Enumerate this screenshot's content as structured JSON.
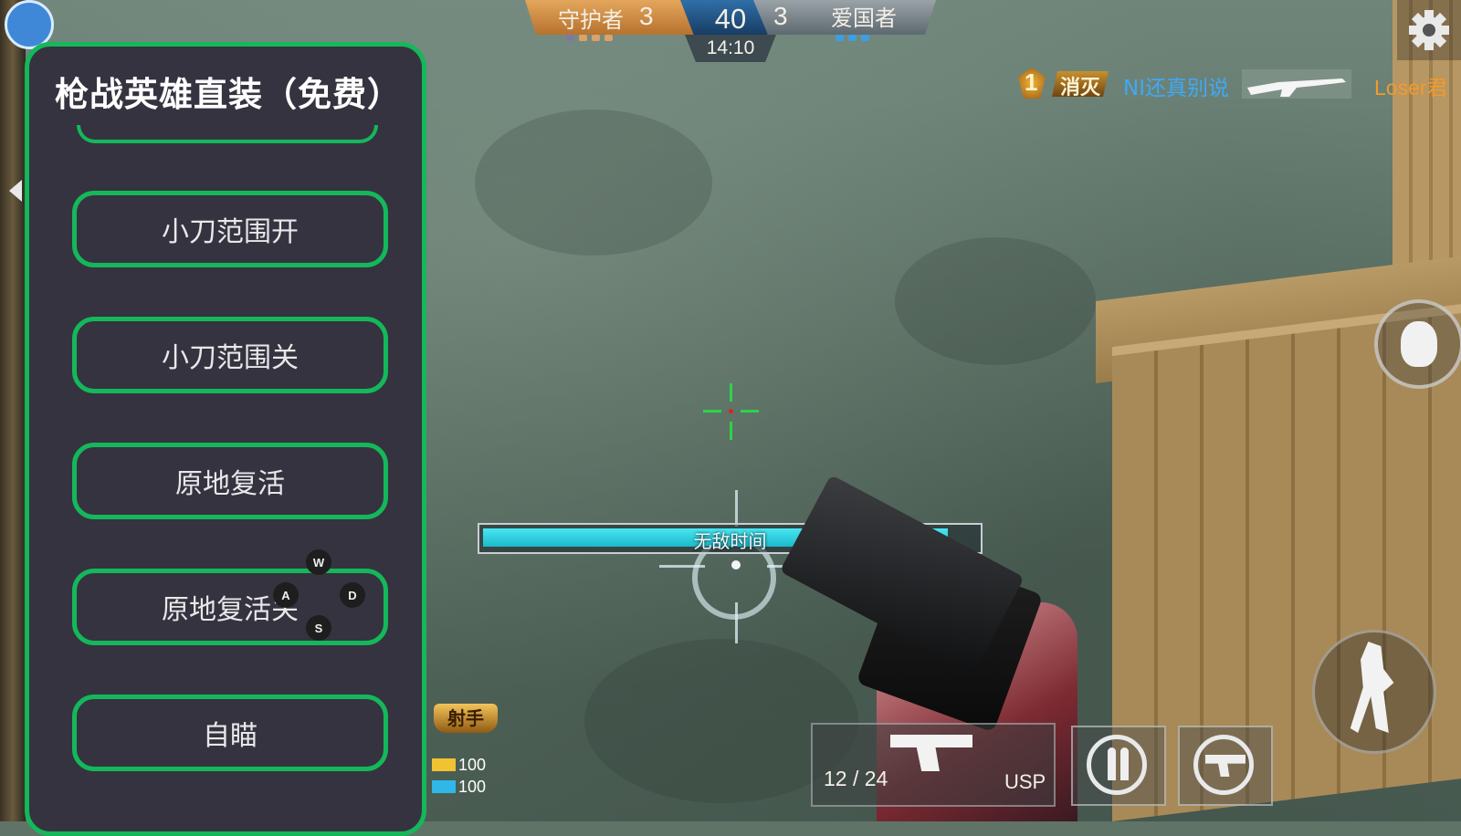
{
  "hud": {
    "team_left_name": "守护者",
    "team_left_score": "3",
    "target_score": "40",
    "team_right_score": "3",
    "team_right_name": "爱国者",
    "timer": "14:10"
  },
  "killfeed": {
    "rank": "1",
    "tag": "消灭",
    "victim": "NI还真别说",
    "killer": "Loser君"
  },
  "status": {
    "invincible_label": "无敌时间",
    "invincible_progress": 0.94
  },
  "weapon": {
    "ammo": "12 / 24",
    "name": "USP"
  },
  "player": {
    "rank_badge": "射手",
    "armor": "100",
    "health": "100"
  },
  "menu": {
    "title": "枪战英雄直装（免费）",
    "buttons": [
      {
        "label": "小刀范围开"
      },
      {
        "label": "小刀范围关"
      },
      {
        "label": "原地复活"
      },
      {
        "label": "原地复活关"
      },
      {
        "label": "自瞄"
      }
    ]
  },
  "keys": {
    "w": "W",
    "a": "A",
    "s": "S",
    "d": "D"
  },
  "colors": {
    "menu_bg": "#35333f",
    "menu_accent": "#14b85a",
    "team_left": "#d08a3e",
    "team_right": "#6d787e",
    "invincible_bar": "#2ec9dc",
    "killfeed_victim": "#3fa9f5",
    "killfeed_killer": "#f39a2b"
  },
  "icons": [
    "settings-gear-icon",
    "grenade-icon",
    "jump-icon",
    "reload-icon",
    "switch-weapon-icon",
    "pistol-icon"
  ]
}
